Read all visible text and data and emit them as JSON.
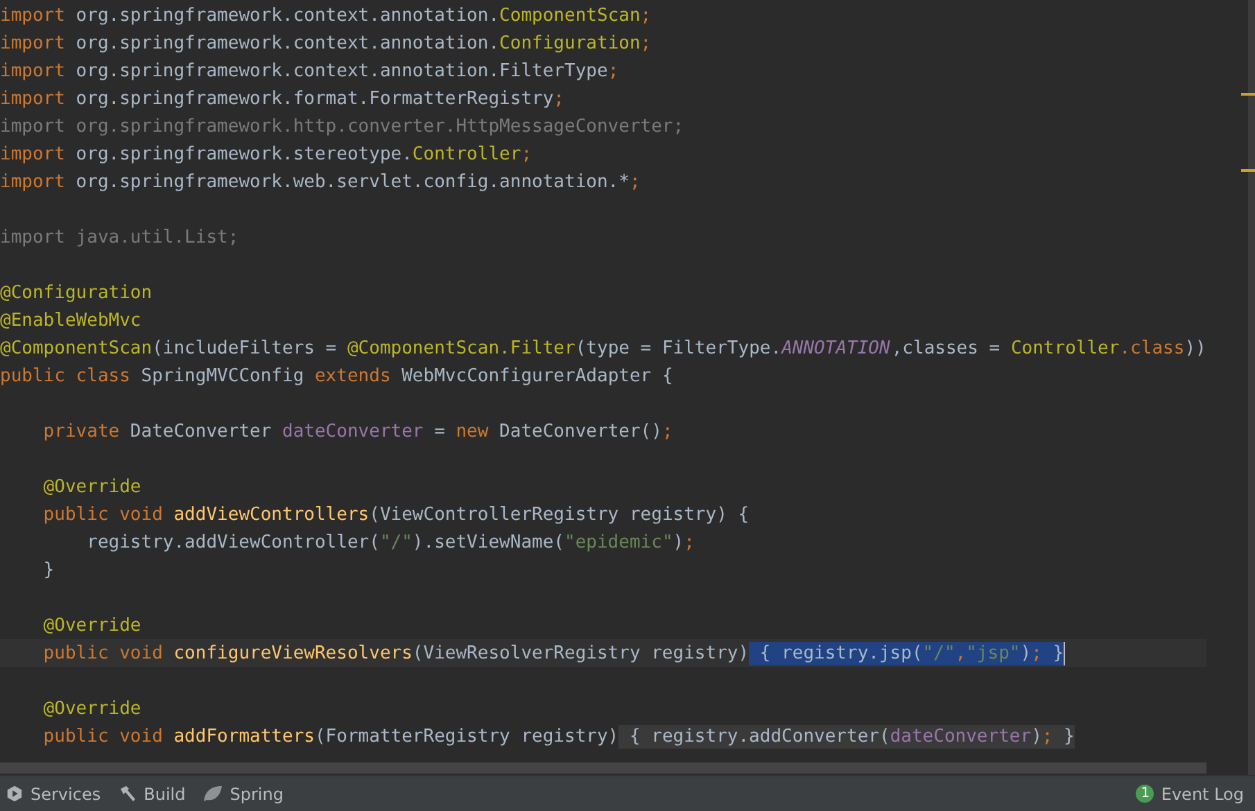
{
  "editor": {
    "lines": [
      {
        "kind": "code",
        "current": false,
        "tokens": [
          {
            "kind": "keyword",
            "text": "import"
          },
          {
            "kind": "plain",
            "text": " org.springframework.context.annotation."
          },
          {
            "kind": "annotation",
            "text": "ComponentScan"
          },
          {
            "kind": "keyword",
            "text": ";"
          }
        ]
      },
      {
        "kind": "code",
        "current": false,
        "tokens": [
          {
            "kind": "keyword",
            "text": "import"
          },
          {
            "kind": "plain",
            "text": " org.springframework.context.annotation."
          },
          {
            "kind": "annotation",
            "text": "Configuration"
          },
          {
            "kind": "keyword",
            "text": ";"
          }
        ]
      },
      {
        "kind": "code",
        "current": false,
        "tokens": [
          {
            "kind": "keyword",
            "text": "import"
          },
          {
            "kind": "plain",
            "text": " org.springframework.context.annotation.FilterType"
          },
          {
            "kind": "keyword",
            "text": ";"
          }
        ]
      },
      {
        "kind": "code",
        "current": false,
        "tokens": [
          {
            "kind": "keyword",
            "text": "import"
          },
          {
            "kind": "plain",
            "text": " org.springframework.format.FormatterRegistry"
          },
          {
            "kind": "keyword",
            "text": ";"
          }
        ]
      },
      {
        "kind": "code",
        "current": false,
        "tokens": [
          {
            "kind": "unused",
            "text": "import org.springframework.http.converter.HttpMessageConverter;"
          }
        ]
      },
      {
        "kind": "code",
        "current": false,
        "tokens": [
          {
            "kind": "keyword",
            "text": "import"
          },
          {
            "kind": "plain",
            "text": " org.springframework.stereotype."
          },
          {
            "kind": "annotation",
            "text": "Controller"
          },
          {
            "kind": "keyword",
            "text": ";"
          }
        ]
      },
      {
        "kind": "code",
        "current": false,
        "tokens": [
          {
            "kind": "keyword",
            "text": "import"
          },
          {
            "kind": "plain",
            "text": " org.springframework.web.servlet.config.annotation.*"
          },
          {
            "kind": "keyword",
            "text": ";"
          }
        ]
      },
      {
        "kind": "blank"
      },
      {
        "kind": "code",
        "current": false,
        "tokens": [
          {
            "kind": "unused",
            "text": "import java.util.List;"
          }
        ]
      },
      {
        "kind": "blank"
      },
      {
        "kind": "code",
        "current": false,
        "tokens": [
          {
            "kind": "annotation",
            "text": "@Configuration"
          }
        ]
      },
      {
        "kind": "code",
        "current": false,
        "tokens": [
          {
            "kind": "annotation",
            "text": "@EnableWebMvc"
          }
        ]
      },
      {
        "kind": "code",
        "current": false,
        "tokens": [
          {
            "kind": "annotation",
            "text": "@ComponentScan"
          },
          {
            "kind": "plain",
            "text": "(includeFilters = "
          },
          {
            "kind": "annotation",
            "text": "@ComponentScan.Filter"
          },
          {
            "kind": "plain",
            "text": "(type = FilterType."
          },
          {
            "kind": "constant",
            "text": "ANNOTATION"
          },
          {
            "kind": "plain",
            "text": ",classes = "
          },
          {
            "kind": "annotation",
            "text": "Controller"
          },
          {
            "kind": "keyword",
            "text": ".class"
          },
          {
            "kind": "plain",
            "text": "))"
          }
        ]
      },
      {
        "kind": "code",
        "current": false,
        "tokens": [
          {
            "kind": "keyword",
            "text": "public class "
          },
          {
            "kind": "plain",
            "text": "SpringMVCConfig "
          },
          {
            "kind": "keyword",
            "text": "extends "
          },
          {
            "kind": "plain",
            "text": "WebMvcConfigurerAdapter {"
          }
        ]
      },
      {
        "kind": "blank"
      },
      {
        "kind": "code",
        "current": false,
        "tokens": [
          {
            "kind": "keyword",
            "text": "    private "
          },
          {
            "kind": "plain",
            "text": "DateConverter "
          },
          {
            "kind": "field",
            "text": "dateConverter"
          },
          {
            "kind": "plain",
            "text": " = "
          },
          {
            "kind": "keyword",
            "text": "new "
          },
          {
            "kind": "plain",
            "text": "DateConverter()"
          },
          {
            "kind": "keyword",
            "text": ";"
          }
        ]
      },
      {
        "kind": "blank"
      },
      {
        "kind": "code",
        "current": false,
        "tokens": [
          {
            "kind": "annotation",
            "text": "    @Override"
          }
        ]
      },
      {
        "kind": "code",
        "current": false,
        "tokens": [
          {
            "kind": "keyword",
            "text": "    public void "
          },
          {
            "kind": "method",
            "text": "addViewControllers"
          },
          {
            "kind": "plain",
            "text": "(ViewControllerRegistry registry) {"
          }
        ]
      },
      {
        "kind": "code",
        "current": false,
        "tokens": [
          {
            "kind": "plain",
            "text": "        registry.addViewController("
          },
          {
            "kind": "string",
            "text": "\"/\""
          },
          {
            "kind": "plain",
            "text": ").setViewName("
          },
          {
            "kind": "string",
            "text": "\"epidemic\""
          },
          {
            "kind": "plain",
            "text": ")"
          },
          {
            "kind": "keyword",
            "text": ";"
          }
        ]
      },
      {
        "kind": "code",
        "current": false,
        "tokens": [
          {
            "kind": "plain",
            "text": "    }"
          }
        ]
      },
      {
        "kind": "blank"
      },
      {
        "kind": "code",
        "current": false,
        "tokens": [
          {
            "kind": "annotation",
            "text": "    @Override"
          }
        ]
      },
      {
        "kind": "code",
        "current": true,
        "segments": [
          {
            "selected": false,
            "tokens": [
              {
                "kind": "keyword",
                "text": "    public void "
              },
              {
                "kind": "method",
                "text": "configureViewResolvers"
              },
              {
                "kind": "plain",
                "text": "(ViewResolverRegistry registry)"
              }
            ]
          },
          {
            "selected": true,
            "tokens": [
              {
                "kind": "plain",
                "text": " { registry.jsp("
              },
              {
                "kind": "string",
                "text": "\"/\""
              },
              {
                "kind": "keyword",
                "text": ","
              },
              {
                "kind": "string",
                "text": "\"jsp\""
              },
              {
                "kind": "plain",
                "text": ")"
              },
              {
                "kind": "keyword",
                "text": ";"
              },
              {
                "kind": "plain",
                "text": " }"
              }
            ]
          }
        ]
      },
      {
        "kind": "blank"
      },
      {
        "kind": "code",
        "current": false,
        "tokens": [
          {
            "kind": "annotation",
            "text": "    @Override"
          }
        ]
      },
      {
        "kind": "code",
        "current": false,
        "segments": [
          {
            "folded": false,
            "tokens": [
              {
                "kind": "keyword",
                "text": "    public void "
              },
              {
                "kind": "method",
                "text": "addFormatters"
              },
              {
                "kind": "plain",
                "text": "(FormatterRegistry registry)"
              }
            ]
          },
          {
            "folded": true,
            "tokens": [
              {
                "kind": "plain",
                "text": " { registry.addConverter("
              },
              {
                "kind": "field",
                "text": "dateConverter"
              },
              {
                "kind": "plain",
                "text": ")"
              },
              {
                "kind": "keyword",
                "text": ";"
              },
              {
                "kind": "plain",
                "text": " }"
              }
            ]
          }
        ]
      }
    ]
  },
  "status_bar": {
    "tools": [
      {
        "kind": "services",
        "label": "Services"
      },
      {
        "kind": "build",
        "label": "Build"
      },
      {
        "kind": "spring",
        "label": "Spring"
      }
    ],
    "event_log": {
      "count": "1",
      "label": "Event Log"
    }
  }
}
